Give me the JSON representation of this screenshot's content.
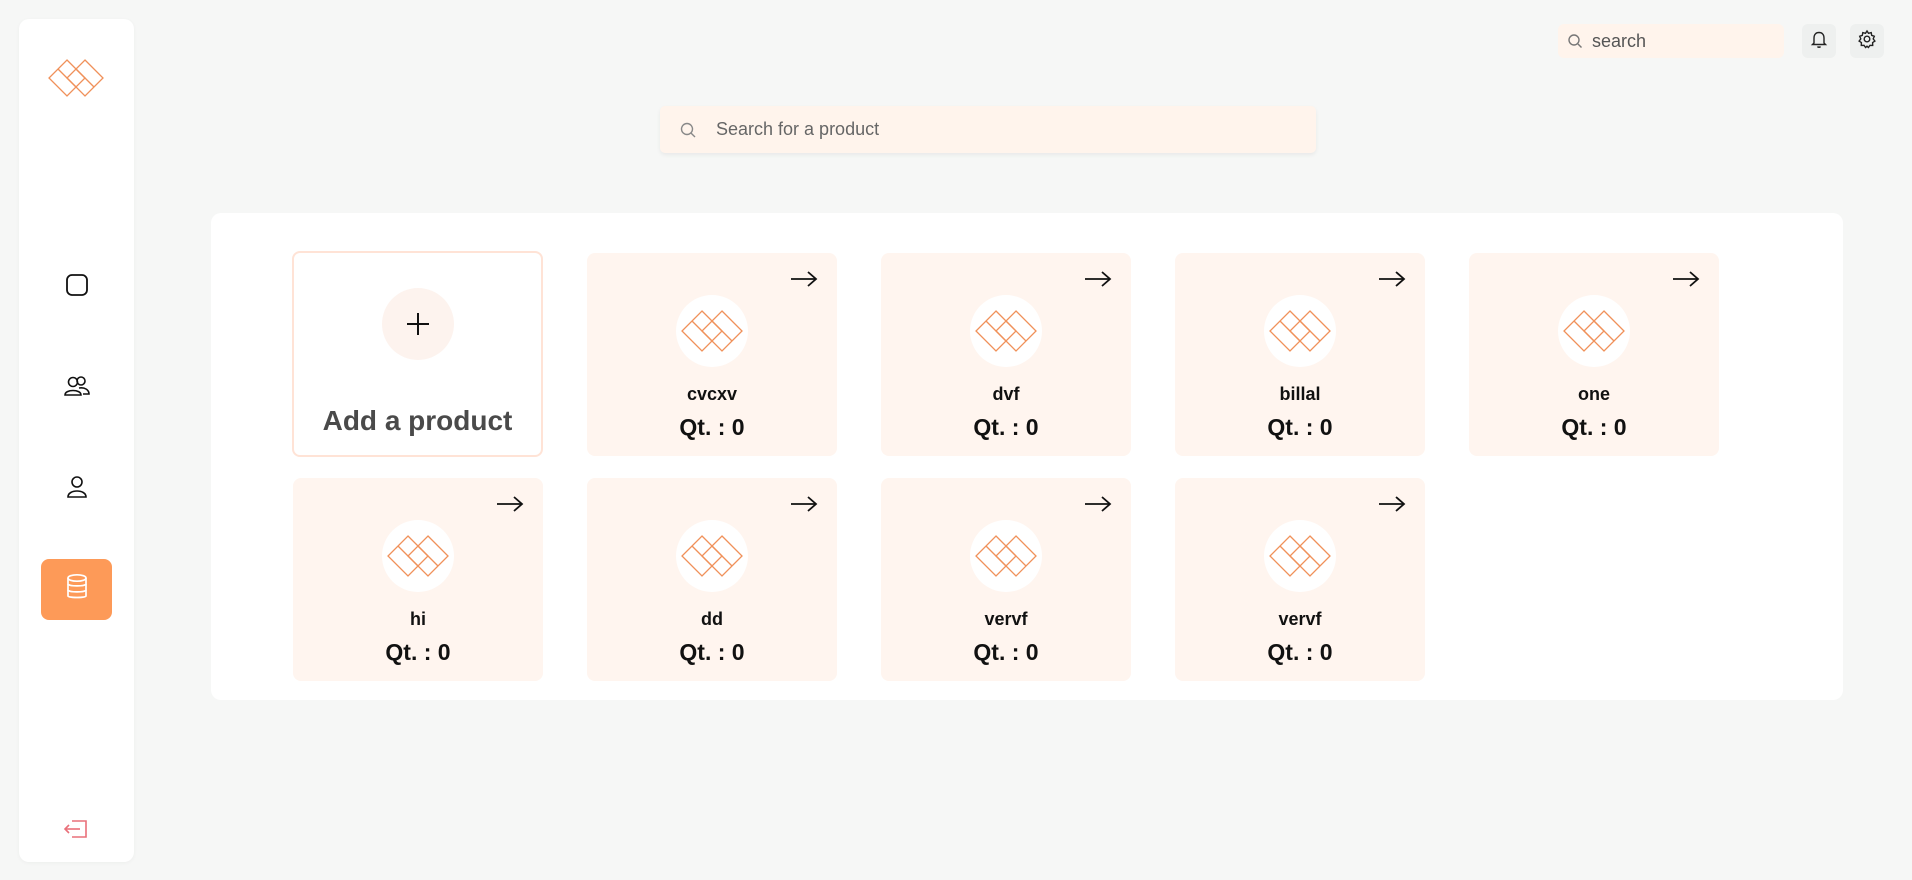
{
  "colors": {
    "accent": "#fd9a58",
    "logo_stroke": "#f0915a",
    "card_bg": "#fff5ef",
    "logout": "#e9707a"
  },
  "sidebar": {
    "logo": "diamond-logo",
    "items": [
      {
        "icon": "square-icon",
        "active": false
      },
      {
        "icon": "users-icon",
        "active": false
      },
      {
        "icon": "user-icon",
        "active": false
      },
      {
        "icon": "database-icon",
        "active": true
      }
    ],
    "logout_icon": "logout-icon"
  },
  "header": {
    "search_placeholder": "search",
    "bell_icon": "bell-icon",
    "settings_icon": "gear-icon"
  },
  "product_search": {
    "placeholder": "Search for a product"
  },
  "add_product": {
    "label": "Add a product"
  },
  "products": [
    {
      "name": "cvcxv",
      "qty": "Qt. : 0"
    },
    {
      "name": "dvf",
      "qty": "Qt. : 0"
    },
    {
      "name": "billal",
      "qty": "Qt. : 0"
    },
    {
      "name": "one",
      "qty": "Qt. : 0"
    },
    {
      "name": "hi",
      "qty": "Qt. : 0"
    },
    {
      "name": "dd",
      "qty": "Qt. : 0"
    },
    {
      "name": "vervf",
      "qty": "Qt. : 0"
    },
    {
      "name": "vervf",
      "qty": "Qt. : 0"
    }
  ]
}
